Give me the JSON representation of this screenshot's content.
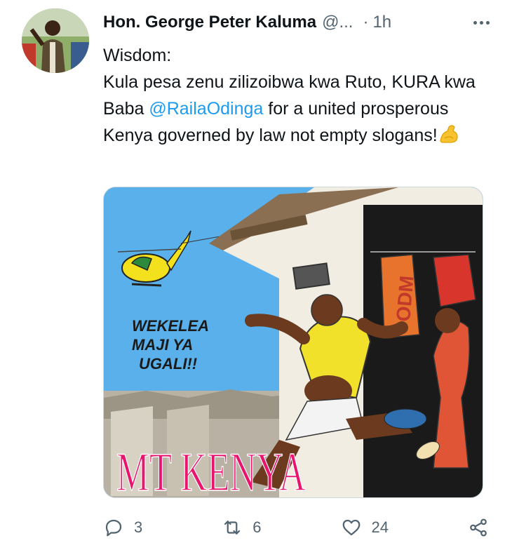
{
  "tweet": {
    "author_name": "Hon. George Peter Kaluma",
    "handle": "@...",
    "separator": "·",
    "time": "1h",
    "text_line1": "Wisdom:",
    "text_part1": "Kula pesa zenu zilizoibwa kwa Ruto, KURA kwa Baba ",
    "mention": "@RailaOdinga",
    "text_part2": " for a united prosperous Kenya governed by law not empty slogans!",
    "emoji": "flexed-biceps-icon"
  },
  "media": {
    "cartoon_speech": [
      "WEKELEA",
      "MAJI YA",
      "UGALI!!"
    ],
    "cartoon_banner": "MT KENYA",
    "cartoon_shirt_text": "ODM"
  },
  "actions": {
    "replies": "3",
    "retweets": "6",
    "likes": "24"
  },
  "colors": {
    "mention": "#1d9bf0",
    "muted": "#536471",
    "banner": "#e8156f"
  }
}
